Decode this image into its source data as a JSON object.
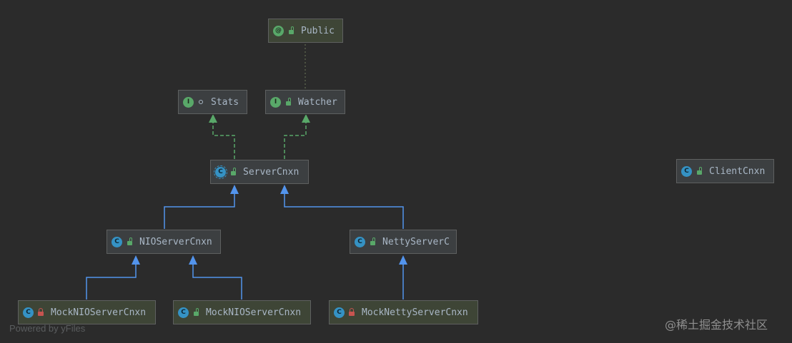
{
  "nodes": {
    "public": {
      "label": "Public",
      "kind_letter": "@",
      "kind_color": "green",
      "modifier": "public-lock"
    },
    "stats": {
      "label": "Stats",
      "kind_letter": "I",
      "kind_color": "green",
      "modifier": "package-dot"
    },
    "watcher": {
      "label": "Watcher",
      "kind_letter": "I",
      "kind_color": "green",
      "modifier": "public-lock"
    },
    "server_cnxn": {
      "label": "ServerCnxn",
      "kind_letter": "C",
      "kind_color": "blue-abstract",
      "modifier": "public-lock"
    },
    "client_cnxn": {
      "label": "ClientCnxn",
      "kind_letter": "C",
      "kind_color": "blue",
      "modifier": "public-lock"
    },
    "nio_server_cnxn": {
      "label": "NIOServerCnxn",
      "kind_letter": "C",
      "kind_color": "blue",
      "modifier": "public-lock"
    },
    "netty_server_cnxn": {
      "label": "NettyServerC",
      "kind_letter": "C",
      "kind_color": "blue",
      "modifier": "public-lock"
    },
    "mock_nio_private": {
      "label": "MockNIOServerCnxn",
      "kind_letter": "C",
      "kind_color": "blue",
      "modifier": "private-lock"
    },
    "mock_nio_public": {
      "label": "MockNIOServerCnxn",
      "kind_letter": "C",
      "kind_color": "blue",
      "modifier": "public-lock"
    },
    "mock_netty": {
      "label": "MockNettyServerCnxn",
      "kind_letter": "C",
      "kind_color": "blue",
      "modifier": "private-lock"
    }
  },
  "edges": [
    {
      "from": "watcher",
      "to": "public",
      "type": "annotation-dotted"
    },
    {
      "from": "server_cnxn",
      "to": "stats",
      "type": "implements"
    },
    {
      "from": "server_cnxn",
      "to": "watcher",
      "type": "implements"
    },
    {
      "from": "nio_server_cnxn",
      "to": "server_cnxn",
      "type": "extends"
    },
    {
      "from": "netty_server_cnxn",
      "to": "server_cnxn",
      "type": "extends"
    },
    {
      "from": "mock_nio_private",
      "to": "nio_server_cnxn",
      "type": "extends"
    },
    {
      "from": "mock_nio_public",
      "to": "nio_server_cnxn",
      "type": "extends"
    },
    {
      "from": "mock_netty",
      "to": "netty_server_cnxn",
      "type": "extends"
    }
  ],
  "colors": {
    "background": "#2b2b2b",
    "extends_edge": "#5394ec",
    "implements_edge": "#59a869",
    "annotation_edge": "#6d7a5a"
  },
  "watermarks": {
    "left": "Powered by yFiles",
    "right": "@稀土掘金技术社区"
  }
}
